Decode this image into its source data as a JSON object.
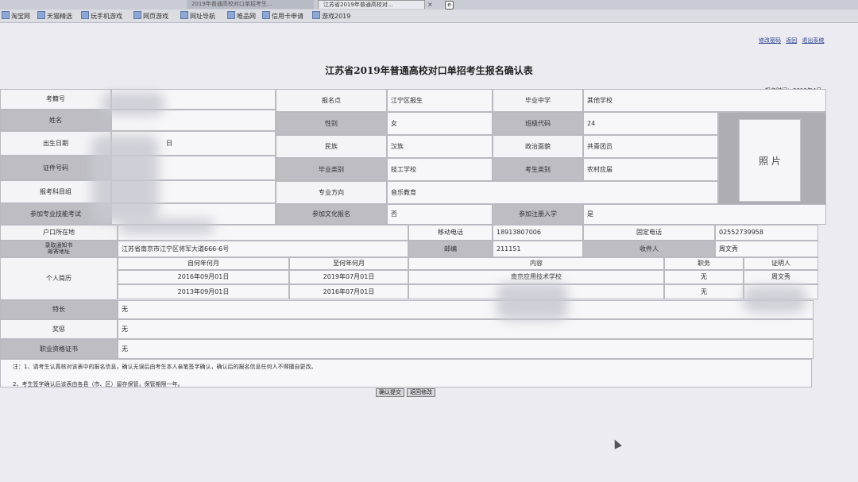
{
  "browser": {
    "tabs": [
      {
        "label": "2019年普通高校对口单招考生..."
      },
      {
        "label": "江苏省2019年普通高校对..."
      }
    ],
    "close_glyph": "×",
    "new_tab_glyph": "e"
  },
  "favorites": [
    {
      "label": "淘宝网"
    },
    {
      "label": "天猫精选"
    },
    {
      "label": "玩手机游戏"
    },
    {
      "label": "网页游戏"
    },
    {
      "label": "网址导航"
    },
    {
      "label": "唯品网"
    },
    {
      "label": "信用卡申请"
    },
    {
      "label": "游戏2019"
    }
  ],
  "top_links": [
    "修改密码",
    "返回",
    "退出系统"
  ],
  "form": {
    "title": "江苏省2019年普通高校对口单招考生报名确认表",
    "report_time": "报名时间：2019年4月",
    "labels": {
      "exam_no": "考籍号",
      "name": "姓名",
      "birth": "出生日期",
      "id_no": "证件号码",
      "subject": "报考科目组",
      "skill": "参加专业技能考试",
      "site": "报名点",
      "gender": "性别",
      "ethnic": "民族",
      "grad_type": "毕业类别",
      "major": "专业方向",
      "culture": "参加文化报名",
      "school": "毕业中学",
      "school_code": "班级代码",
      "political": "政治面貌",
      "student_type": "考生类别",
      "reg_enroll": "参加注册入学",
      "hukou": "户口所在地",
      "mail_addr": "录取通知书\n邮寄地址",
      "mobile": "移动电话",
      "phone": "固定电话",
      "postcode": "邮编",
      "recipient": "收件人",
      "resume": "个人简历",
      "specialty": "特长",
      "awards": "奖惩",
      "certs": "职业资格证书",
      "photo": "照 片"
    },
    "values": {
      "birth_suffix": "日",
      "site": "江宁区报生",
      "gender": "女",
      "ethnic": "汉族",
      "grad_type": "技工学校",
      "major": "音乐教育",
      "culture": "否",
      "school": "其他学校",
      "school_code": "24",
      "political": "共青团员",
      "student_type": "农村应届",
      "reg_enroll": "是",
      "mail_addr": "江苏省南京市江宁区将军大道666-6号",
      "mobile": "18913807006",
      "phone": "02552739958",
      "postcode": "211151",
      "recipient": "周文秀",
      "specialty": "无",
      "awards": "无",
      "certs": "无"
    },
    "resume": {
      "headers": [
        "自何年何月",
        "至何年何月",
        "内容",
        "职务",
        "证明人"
      ],
      "rows": [
        [
          "2016年09月01日",
          "2019年07月01日",
          "南京应用技术学校",
          "无",
          "周文秀"
        ],
        [
          "2013年09月01日",
          "2016年07月01日",
          "",
          "无",
          ""
        ]
      ]
    },
    "notes": [
      "注：1、请考生认真核对该表中的报名信息，确认无误后由考生本人亲笔签字确认，确认后的报名信息任何人不得擅自更改。",
      "2、考生签字确认后该表由各县（市、区）留存保管，保管期限一年。"
    ],
    "buttons": {
      "confirm": "确认提交",
      "back": "返回修改"
    }
  },
  "colors": {
    "label_bg": "#bdbdc3",
    "value_bg": "#f7f7f9",
    "page_bg": "#ebebf1"
  }
}
